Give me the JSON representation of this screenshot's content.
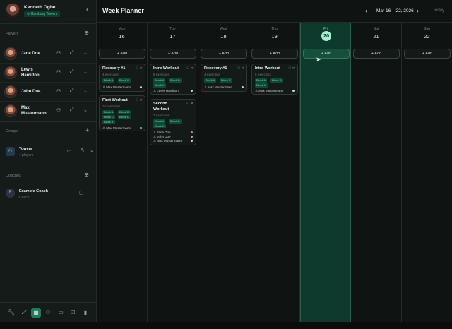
{
  "profile": {
    "name": "Kenneth Ogbe",
    "team": "Hamburg Towers",
    "collapse_icon": "chevron-left-icon"
  },
  "players": {
    "title": "Players",
    "items": [
      {
        "name1": "Jane Doe",
        "name2": ""
      },
      {
        "name1": "Lewis",
        "name2": "Hamilton"
      },
      {
        "name1": "John Doe",
        "name2": ""
      },
      {
        "name1": "Max",
        "name2": "Mustermann"
      }
    ]
  },
  "groups": {
    "title": "Groups",
    "items": [
      {
        "name": "Towers",
        "sub": "4 players"
      }
    ]
  },
  "coaches": {
    "title": "Coaches",
    "items": [
      {
        "initial": "E",
        "name": "Example Coach",
        "sub": "Coach"
      }
    ]
  },
  "header": {
    "title": "Week Planner",
    "range": "Mar 16 – 22, 2026",
    "today": "Today"
  },
  "add_label": "+ Add",
  "days": [
    {
      "name": "Mon",
      "num": "16"
    },
    {
      "name": "Tue",
      "num": "17"
    },
    {
      "name": "Wed",
      "num": "18"
    },
    {
      "name": "Thu",
      "num": "19"
    },
    {
      "name": "Fri",
      "num": "20"
    },
    {
      "name": "Sat",
      "num": "21"
    },
    {
      "name": "Sun",
      "num": "22"
    }
  ],
  "cards": {
    "mon1": {
      "title": "Recovery #1",
      "sub": "4 exercises",
      "tags": [
        "Block A",
        "Block X"
      ],
      "assignee": "Max Mustermann"
    },
    "mon2": {
      "title": "First Workout",
      "sub": "10 exercises",
      "tags": [
        "Block A",
        "Block B",
        "Block C",
        "Block D",
        "Block X"
      ],
      "assignee": "Max Mustermann"
    },
    "tue1": {
      "title": "Intro Workout",
      "sub": "6 exercises",
      "tags": [
        "Block A",
        "Block B",
        "Block X"
      ],
      "assignee": "Lewis Hamilton"
    },
    "tue2": {
      "title1": "Second",
      "title2": "Workout",
      "sub": "7 exercises",
      "tags": [
        "Block A",
        "Block B",
        "Block X"
      ],
      "assignees": [
        "Jane Doe",
        "John Doe",
        "Max Mustermann"
      ]
    },
    "wed1": {
      "title": "Recovery #1",
      "sub": "4 exercises",
      "tags": [
        "Block A",
        "Block X"
      ],
      "assignee": "Max Mustermann"
    },
    "thu1": {
      "title": "Intro Workout",
      "sub": "6 exercises",
      "tags": [
        "Block A",
        "Block B",
        "Block X"
      ],
      "assignee": "Max Mustermann"
    }
  }
}
